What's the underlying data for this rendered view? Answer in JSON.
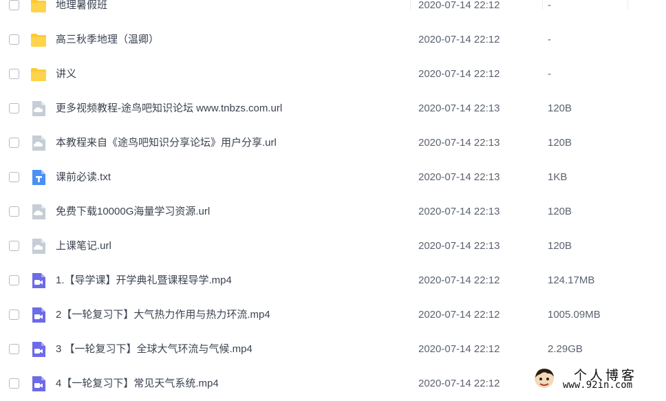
{
  "files": [
    {
      "name": "地理暑假班",
      "date": "2020-07-14 22:12",
      "size": "-",
      "icon": "folder-icon"
    },
    {
      "name": "高三秋季地理（温卿）",
      "date": "2020-07-14 22:12",
      "size": "-",
      "icon": "folder-icon"
    },
    {
      "name": "讲义",
      "date": "2020-07-14 22:12",
      "size": "-",
      "icon": "folder-icon"
    },
    {
      "name": "更多视频教程-途鸟吧知识论坛 www.tnbzs.com.url",
      "date": "2020-07-14 22:13",
      "size": "120B",
      "icon": "url-file-icon"
    },
    {
      "name": "本教程来自《途鸟吧知识分享论坛》用户分享.url",
      "date": "2020-07-14 22:13",
      "size": "120B",
      "icon": "url-file-icon"
    },
    {
      "name": "课前必读.txt",
      "date": "2020-07-14 22:13",
      "size": "1KB",
      "icon": "text-file-icon"
    },
    {
      "name": "免费下载10000G海量学习资源.url",
      "date": "2020-07-14 22:13",
      "size": "120B",
      "icon": "url-file-icon"
    },
    {
      "name": "上课笔记.url",
      "date": "2020-07-14 22:13",
      "size": "120B",
      "icon": "url-file-icon"
    },
    {
      "name": "1.【导学课】开学典礼暨课程导学.mp4",
      "date": "2020-07-14 22:12",
      "size": "124.17MB",
      "icon": "video-file-icon"
    },
    {
      "name": "2【一轮复习下】大气热力作用与热力环流.mp4",
      "date": "2020-07-14 22:12",
      "size": "1005.09MB",
      "icon": "video-file-icon"
    },
    {
      "name": "3 【一轮复习下】全球大气环流与气候.mp4",
      "date": "2020-07-14 22:12",
      "size": "2.29GB",
      "icon": "video-file-icon"
    },
    {
      "name": "4【一轮复习下】常见天气系统.mp4",
      "date": "2020-07-14 22:12",
      "size": "",
      "icon": "video-file-icon"
    }
  ],
  "colors": {
    "folder": "#ffc933",
    "url_file": "#c5cdd6",
    "text_file": "#4a90f5",
    "video_file": "#6c6be8"
  },
  "watermark": {
    "title": "个人博客",
    "url": "www.92in.com"
  }
}
